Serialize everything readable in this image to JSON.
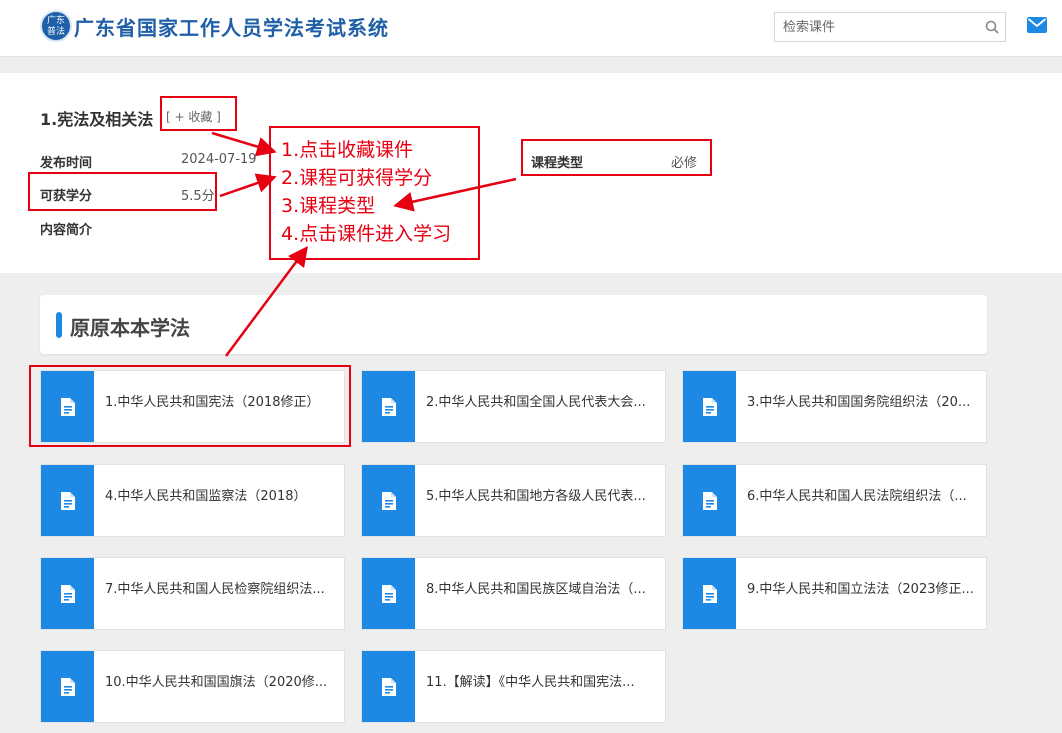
{
  "header": {
    "logo_text_top": "广东",
    "logo_text_bottom": "普法",
    "site_title": "广东省国家工作人员学法考试系统",
    "search_placeholder": "检索课件"
  },
  "course": {
    "title": "1.宪法及相关法",
    "favorite_label": "[ + 收藏 ]",
    "publish_label": "发布时间",
    "publish_value": "2024-07-19",
    "credit_label": "可获学分",
    "credit_value": "5.5分",
    "intro_label": "内容简介",
    "type_label": "课程类型",
    "type_value": "必修"
  },
  "section": {
    "title": "原原本本学法"
  },
  "cards": [
    "1.中华人民共和国宪法（2018修正）",
    "2.中华人民共和国全国人民代表大会...",
    "3.中华人民共和国国务院组织法（20...",
    "4.中华人民共和国监察法（2018）",
    "5.中华人民共和国地方各级人民代表...",
    "6.中华人民共和国人民法院组织法（...",
    "7.中华人民共和国人民检察院组织法...",
    "8.中华人民共和国民族区域自治法（...",
    "9.中华人民共和国立法法（2023修正...",
    "10.中华人民共和国国旗法（2020修...",
    "11.【解读】《中华人民共和国宪法..."
  ],
  "annotations": [
    "1.点击收藏课件",
    "2.课程可获得学分",
    "3.课程类型",
    "4.点击课件进入学习"
  ],
  "colors": {
    "accent": "#1e88e5",
    "brand": "#1e5fa8",
    "annotation": "#e60012"
  }
}
